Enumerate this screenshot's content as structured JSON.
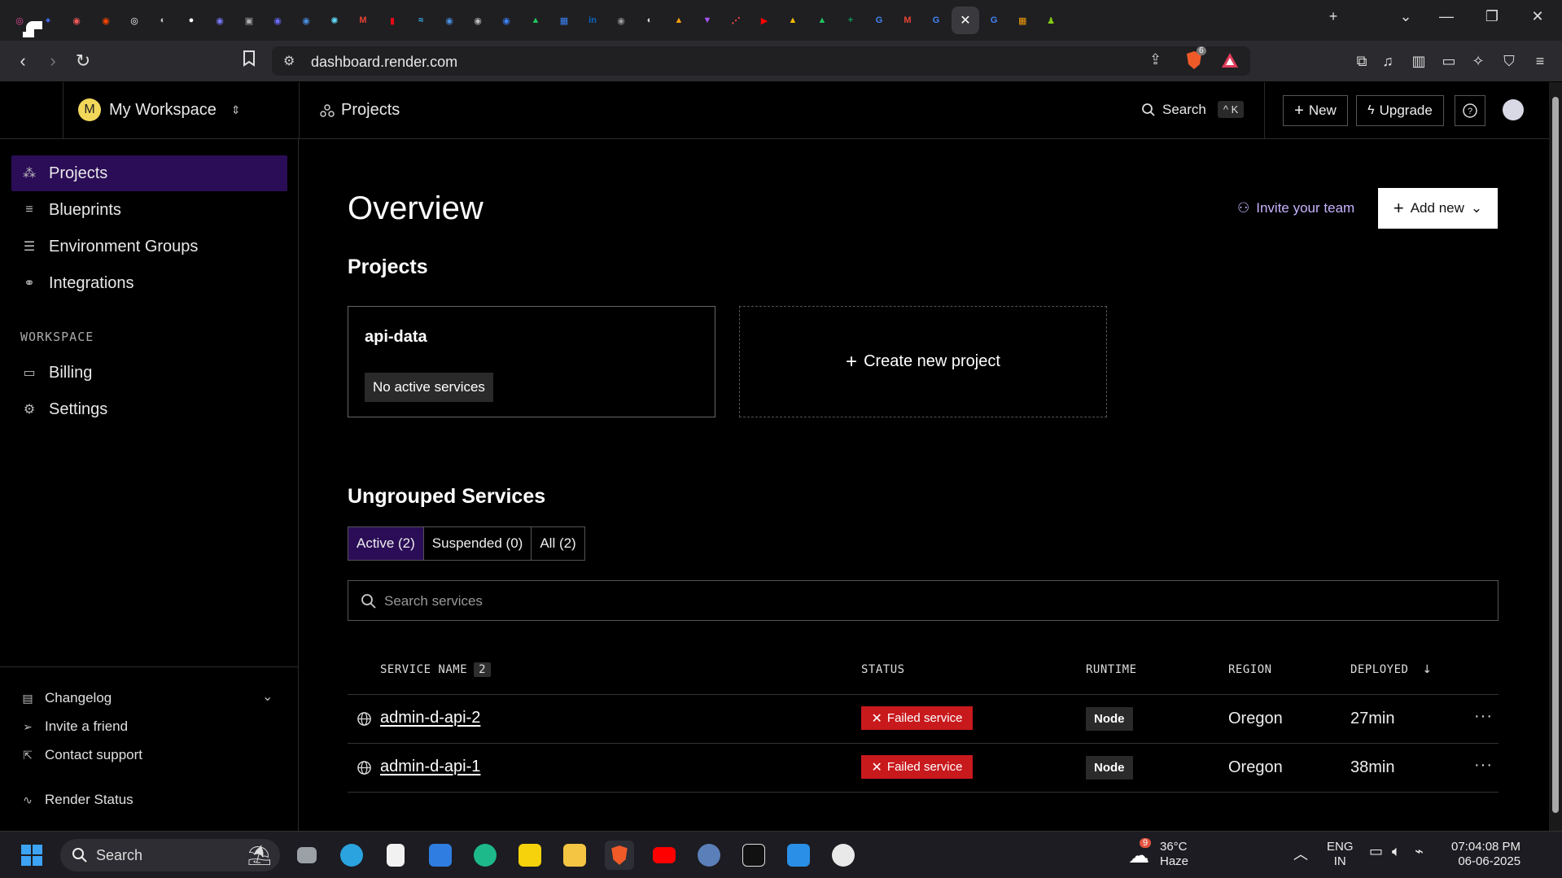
{
  "browser": {
    "tab_icons": [
      {
        "name": "tab-icon-1",
        "color": "#e94a9a",
        "glyph": "◎"
      },
      {
        "name": "tab-icon-2",
        "color": "#4a6cf7",
        "glyph": "✦"
      },
      {
        "name": "tab-icon-3",
        "color": "#f55a5a",
        "glyph": "◉"
      },
      {
        "name": "tab-icon-4",
        "color": "#ff4500",
        "glyph": "◉"
      },
      {
        "name": "tab-icon-5",
        "color": "#ffffff",
        "glyph": "◎"
      },
      {
        "name": "tab-icon-6",
        "color": "#cccccc",
        "glyph": "◐"
      },
      {
        "name": "tab-icon-7",
        "color": "#ffffff",
        "glyph": "●"
      },
      {
        "name": "tab-icon-8",
        "color": "#7a7aff",
        "glyph": "◉"
      },
      {
        "name": "tab-icon-9",
        "color": "#aaaaaa",
        "glyph": "▣"
      },
      {
        "name": "tab-icon-10",
        "color": "#6b6bff",
        "glyph": "◉"
      },
      {
        "name": "tab-icon-11",
        "color": "#4a90e2",
        "glyph": "◉"
      },
      {
        "name": "tab-icon-12",
        "color": "#61dafb",
        "glyph": "✺"
      },
      {
        "name": "tab-icon-13",
        "color": "#ea4335",
        "glyph": "M"
      },
      {
        "name": "tab-icon-14",
        "color": "#e50914",
        "glyph": "▮"
      },
      {
        "name": "tab-icon-15",
        "color": "#38bdf8",
        "glyph": "≈"
      },
      {
        "name": "tab-icon-16",
        "color": "#4a90e2",
        "glyph": "◉"
      },
      {
        "name": "tab-icon-17",
        "color": "#bbbbbb",
        "glyph": "◉"
      },
      {
        "name": "tab-icon-18",
        "color": "#3b82f6",
        "glyph": "◉"
      },
      {
        "name": "tab-icon-19",
        "color": "#22c55e",
        "glyph": "▲"
      },
      {
        "name": "tab-icon-20",
        "color": "#3b82f6",
        "glyph": "▦"
      },
      {
        "name": "tab-icon-21",
        "color": "#0a66c2",
        "glyph": "in"
      },
      {
        "name": "tab-icon-22",
        "color": "#999999",
        "glyph": "◉"
      },
      {
        "name": "tab-icon-23",
        "color": "#dddddd",
        "glyph": "◐"
      },
      {
        "name": "tab-icon-24",
        "color": "#f59e0b",
        "glyph": "▲"
      },
      {
        "name": "tab-icon-25",
        "color": "#a855f7",
        "glyph": "▼"
      },
      {
        "name": "tab-icon-26",
        "color": "#ef4444",
        "glyph": "⋰"
      },
      {
        "name": "tab-icon-27",
        "color": "#ff0000",
        "glyph": "▶"
      },
      {
        "name": "tab-icon-28",
        "color": "#fbbc04",
        "glyph": "▲"
      },
      {
        "name": "tab-icon-29",
        "color": "#22c55e",
        "glyph": "▲"
      },
      {
        "name": "tab-icon-30",
        "color": "#0f9d58",
        "glyph": "+"
      },
      {
        "name": "tab-icon-31",
        "color": "#4285f4",
        "glyph": "G"
      },
      {
        "name": "tab-icon-32",
        "color": "#ea4335",
        "glyph": "M"
      },
      {
        "name": "tab-icon-33",
        "color": "#4285f4",
        "glyph": "G"
      },
      {
        "name": "tab-icon-34",
        "color": "#4285f4",
        "glyph": "G"
      },
      {
        "name": "tab-icon-35",
        "color": "#f59e0b",
        "glyph": "▦"
      },
      {
        "name": "tab-icon-36",
        "color": "#84cc16",
        "glyph": "♟"
      }
    ],
    "url": "dashboard.render.com",
    "brave_badge": "6"
  },
  "header": {
    "workspace_initial": "M",
    "workspace_name": "My Workspace",
    "breadcrumb": "Projects",
    "search_label": "Search",
    "search_shortcut": "^ K",
    "new_label": "New",
    "upgrade_label": "Upgrade"
  },
  "sidebar": {
    "items": [
      {
        "label": "Projects",
        "icon": "projects-icon",
        "active": true
      },
      {
        "label": "Blueprints",
        "icon": "blueprints-icon",
        "active": false
      },
      {
        "label": "Environment Groups",
        "icon": "env-groups-icon",
        "active": false
      },
      {
        "label": "Integrations",
        "icon": "integrations-icon",
        "active": false
      }
    ],
    "section_label": "WORKSPACE",
    "workspace_items": [
      {
        "label": "Billing",
        "icon": "billing-icon"
      },
      {
        "label": "Settings",
        "icon": "settings-icon"
      }
    ],
    "bottom_items": [
      {
        "label": "Changelog",
        "icon": "changelog-icon"
      },
      {
        "label": "Invite a friend",
        "icon": "send-icon"
      },
      {
        "label": "Contact support",
        "icon": "external-link-icon"
      }
    ],
    "status_label": "Render Status"
  },
  "main": {
    "title": "Overview",
    "invite_label": "Invite your team",
    "add_new_label": "Add new",
    "projects_heading": "Projects",
    "project": {
      "name": "api-data",
      "badge": "No active services"
    },
    "create_project_label": "Create new project",
    "services_heading": "Ungrouped Services",
    "filter_tabs": [
      {
        "label": "Active (2)",
        "active": true
      },
      {
        "label": "Suspended (0)",
        "active": false
      },
      {
        "label": "All (2)",
        "active": false
      }
    ],
    "search_placeholder": "Search services",
    "columns": {
      "service_name": "SERVICE NAME",
      "service_count": "2",
      "status": "STATUS",
      "runtime": "RUNTIME",
      "region": "REGION",
      "deployed": "DEPLOYED"
    },
    "services": [
      {
        "name": "admin-d-api-2",
        "status": "Failed service",
        "runtime": "Node",
        "region": "Oregon",
        "deployed": "27min"
      },
      {
        "name": "admin-d-api-1",
        "status": "Failed service",
        "runtime": "Node",
        "region": "Oregon",
        "deployed": "38min"
      }
    ],
    "accent_color": "#2b0d57",
    "failed_color": "#c8191d"
  },
  "taskbar": {
    "search_label": "Search",
    "weather_temp": "36°C",
    "weather_desc": "Haze",
    "weather_badge": "9",
    "lang_line1": "ENG",
    "lang_line2": "IN",
    "time": "07:04:08 PM",
    "date": "06-06-2025"
  }
}
